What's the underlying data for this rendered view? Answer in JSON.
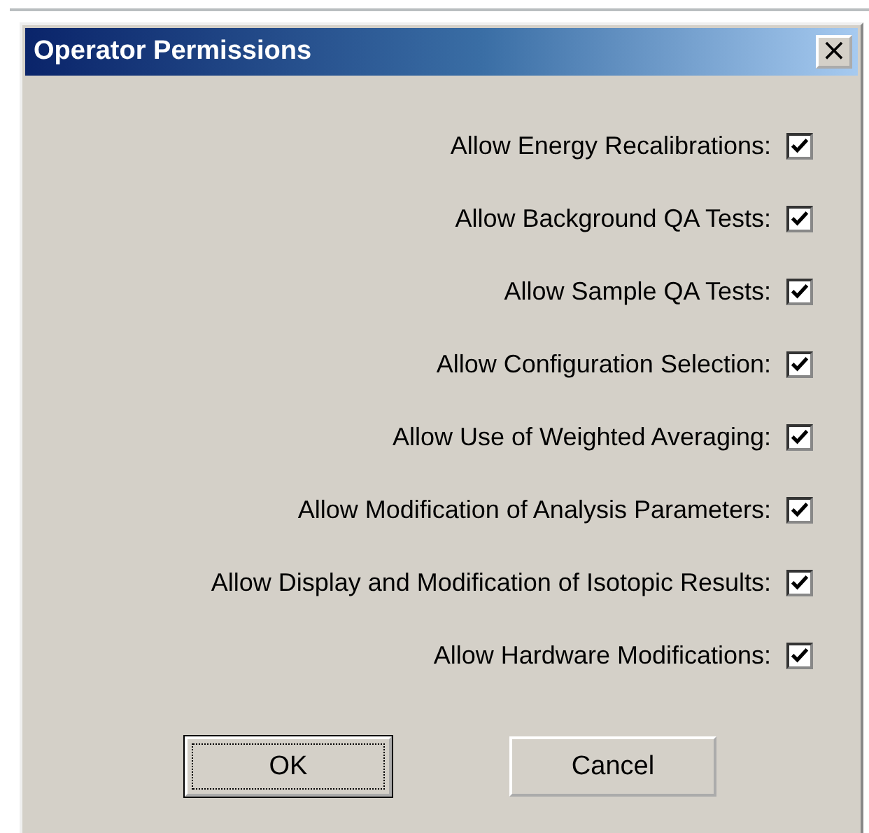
{
  "window": {
    "title": "Operator Permissions",
    "close": "×"
  },
  "permissions": [
    {
      "label": "Allow Energy Recalibrations:",
      "checked": true
    },
    {
      "label": "Allow Background QA Tests:",
      "checked": true
    },
    {
      "label": "Allow Sample QA Tests:",
      "checked": true
    },
    {
      "label": "Allow Configuration Selection:",
      "checked": true
    },
    {
      "label": "Allow Use of Weighted Averaging:",
      "checked": true
    },
    {
      "label": "Allow Modification of Analysis Parameters:",
      "checked": true
    },
    {
      "label": "Allow Display and Modification of Isotopic Results:",
      "checked": true
    },
    {
      "label": "Allow Hardware Modifications:",
      "checked": true
    }
  ],
  "buttons": [
    {
      "label": "OK",
      "focused": true
    },
    {
      "label": "Cancel",
      "focused": false
    }
  ]
}
